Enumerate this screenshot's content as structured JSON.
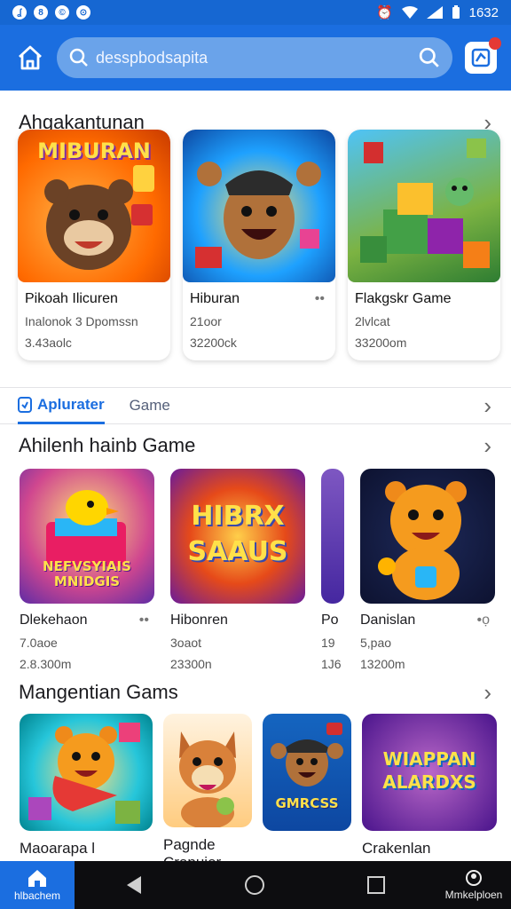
{
  "status_bar": {
    "time": "1632"
  },
  "search": {
    "placeholder": "desspbodsapita"
  },
  "section1": {
    "title": "Ahgakantunan",
    "cards": [
      {
        "art": "MIBURAN",
        "title": "Pikoah Ilicuren",
        "line2": "Inalonok 3 Dpomssn",
        "line3": "3.43aolc"
      },
      {
        "art": "",
        "title": "Hiburan",
        "line2": "21oor",
        "line3": "32200ck"
      },
      {
        "art": "",
        "title": "Flakgskr Game",
        "line2": "2lvlcat",
        "line3": "33200om"
      }
    ]
  },
  "tabs": [
    {
      "label": "Aplurater"
    },
    {
      "label": "Game"
    }
  ],
  "section2": {
    "title": "Ahilenh hainb Game",
    "tiles": [
      {
        "art": "NEFVSYIAIS MNIDGIS",
        "title": "Dlekehaon",
        "line2": "7.0aoe",
        "line3": "2.8.300m"
      },
      {
        "art": "HIBRX SAAUS",
        "title": "Hibonren",
        "line2": "3oaot",
        "line3": "23300n"
      },
      {
        "art": "",
        "title": "Po",
        "line2": "19",
        "line3": "1J6"
      },
      {
        "art": "",
        "title": "Danislan",
        "line2": "5,pao",
        "line3": "13200m"
      }
    ]
  },
  "section3": {
    "title": "Mangentian Gams",
    "tiles": [
      {
        "art": "",
        "label": "Maoarapa l"
      },
      {
        "art": "",
        "label": "Pagnde Crapuier"
      },
      {
        "art": "GMRCSS",
        "label": ""
      },
      {
        "art": "WIAPPAN ALARDXS",
        "label": "Crakenlan"
      }
    ]
  },
  "navbar": {
    "home_label": "hlbachem",
    "extra_label": "Mmkelploen"
  }
}
